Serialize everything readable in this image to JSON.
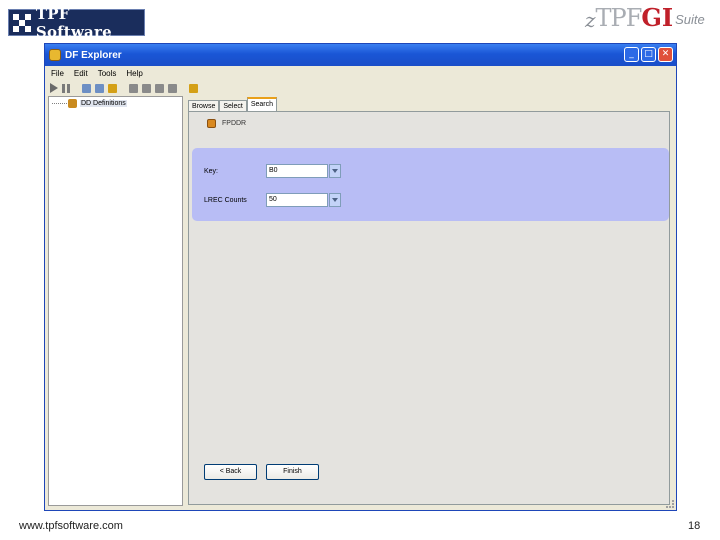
{
  "slide": {
    "logo_text": "TPF Software",
    "brand": {
      "z": "z",
      "tpf": "TPF",
      "gi": "GI",
      "suite": "Suite"
    },
    "footer_url": "www.tpfsoftware.com",
    "page_number": "18"
  },
  "window": {
    "title": "DF Explorer",
    "menu": [
      "File",
      "Edit",
      "Tools",
      "Help"
    ],
    "toolbar_icons": [
      "play-icon",
      "pause-icon",
      "copy-icon",
      "branch-icon",
      "paste-icon",
      "stop-icon",
      "step-icon",
      "cut-icon",
      "square-icon",
      "wrench-icon"
    ]
  },
  "tree": {
    "root_label": "DD Definitions"
  },
  "tabs": [
    {
      "label": "Browse",
      "active": false
    },
    {
      "label": "Select",
      "active": false
    },
    {
      "label": "Search",
      "active": true
    }
  ],
  "search": {
    "section_title": "FPDDR",
    "key_label": "Key:",
    "key_value": "B0",
    "lrec_label": "LREC Counts",
    "lrec_value": "50"
  },
  "buttons": {
    "back": "< Back",
    "finish": "Finish"
  },
  "colors": {
    "form_bg": "#b8bdf5",
    "title_blue": "#1a56d6",
    "brand_red": "#c0202a"
  }
}
